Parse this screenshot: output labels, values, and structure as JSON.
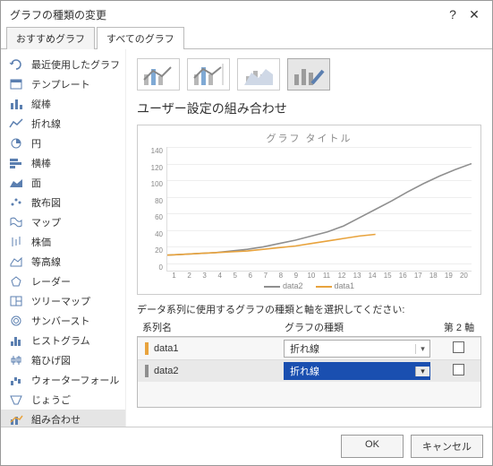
{
  "window": {
    "title": "グラフの種類の変更",
    "help": "?",
    "close": "✕"
  },
  "tabs": {
    "recommended": "おすすめグラフ",
    "all": "すべてのグラフ"
  },
  "sidebar": {
    "items": [
      {
        "label": "最近使用したグラフ",
        "icon": "recent"
      },
      {
        "label": "テンプレート",
        "icon": "template"
      },
      {
        "label": "縦棒",
        "icon": "column"
      },
      {
        "label": "折れ線",
        "icon": "line"
      },
      {
        "label": "円",
        "icon": "pie"
      },
      {
        "label": "横棒",
        "icon": "bar"
      },
      {
        "label": "面",
        "icon": "area"
      },
      {
        "label": "散布図",
        "icon": "scatter"
      },
      {
        "label": "マップ",
        "icon": "map"
      },
      {
        "label": "株価",
        "icon": "stock"
      },
      {
        "label": "等高線",
        "icon": "surface"
      },
      {
        "label": "レーダー",
        "icon": "radar"
      },
      {
        "label": "ツリーマップ",
        "icon": "treemap"
      },
      {
        "label": "サンバースト",
        "icon": "sunburst"
      },
      {
        "label": "ヒストグラム",
        "icon": "histogram"
      },
      {
        "label": "箱ひげ図",
        "icon": "boxwhisker"
      },
      {
        "label": "ウォーターフォール",
        "icon": "waterfall"
      },
      {
        "label": "じょうご",
        "icon": "funnel"
      },
      {
        "label": "組み合わせ",
        "icon": "combo"
      }
    ],
    "selected_index": 18
  },
  "main": {
    "section_title": "ユーザー設定の組み合わせ",
    "selected_thumb": 3
  },
  "instructions": "データ系列に使用するグラフの種類と軸を選択してください:",
  "columns": {
    "series": "系列名",
    "type": "グラフの種類",
    "axis2": "第 2 軸"
  },
  "rows": [
    {
      "name": "data1",
      "type": "折れ線",
      "color": "#e8a33d",
      "selected": false,
      "axis2": false
    },
    {
      "name": "data2",
      "type": "折れ線",
      "color": "#8f8f8f",
      "selected": true,
      "axis2": false
    }
  ],
  "footer": {
    "ok": "OK",
    "cancel": "キャンセル"
  },
  "chart_data": {
    "type": "line",
    "title": "グラフ タイトル",
    "xlabel": "",
    "ylabel": "",
    "ylim": [
      0,
      140
    ],
    "yticks": [
      0,
      20,
      40,
      60,
      80,
      100,
      120,
      140
    ],
    "categories": [
      1,
      2,
      3,
      4,
      5,
      6,
      7,
      8,
      9,
      10,
      11,
      12,
      13,
      14,
      15,
      16,
      17,
      18,
      19,
      20
    ],
    "series": [
      {
        "name": "data2",
        "color": "#8f8f8f",
        "values": [
          10,
          11,
          12,
          13,
          15,
          17,
          20,
          24,
          28,
          33,
          38,
          45,
          55,
          65,
          75,
          86,
          96,
          105,
          113,
          120
        ]
      },
      {
        "name": "data1",
        "color": "#e8a33d",
        "values": [
          10,
          11,
          12,
          13,
          14,
          15,
          17,
          19,
          21,
          24,
          27,
          30,
          33,
          35,
          null,
          null,
          null,
          null,
          null,
          null
        ]
      }
    ],
    "legend": [
      "data2",
      "data1"
    ]
  }
}
